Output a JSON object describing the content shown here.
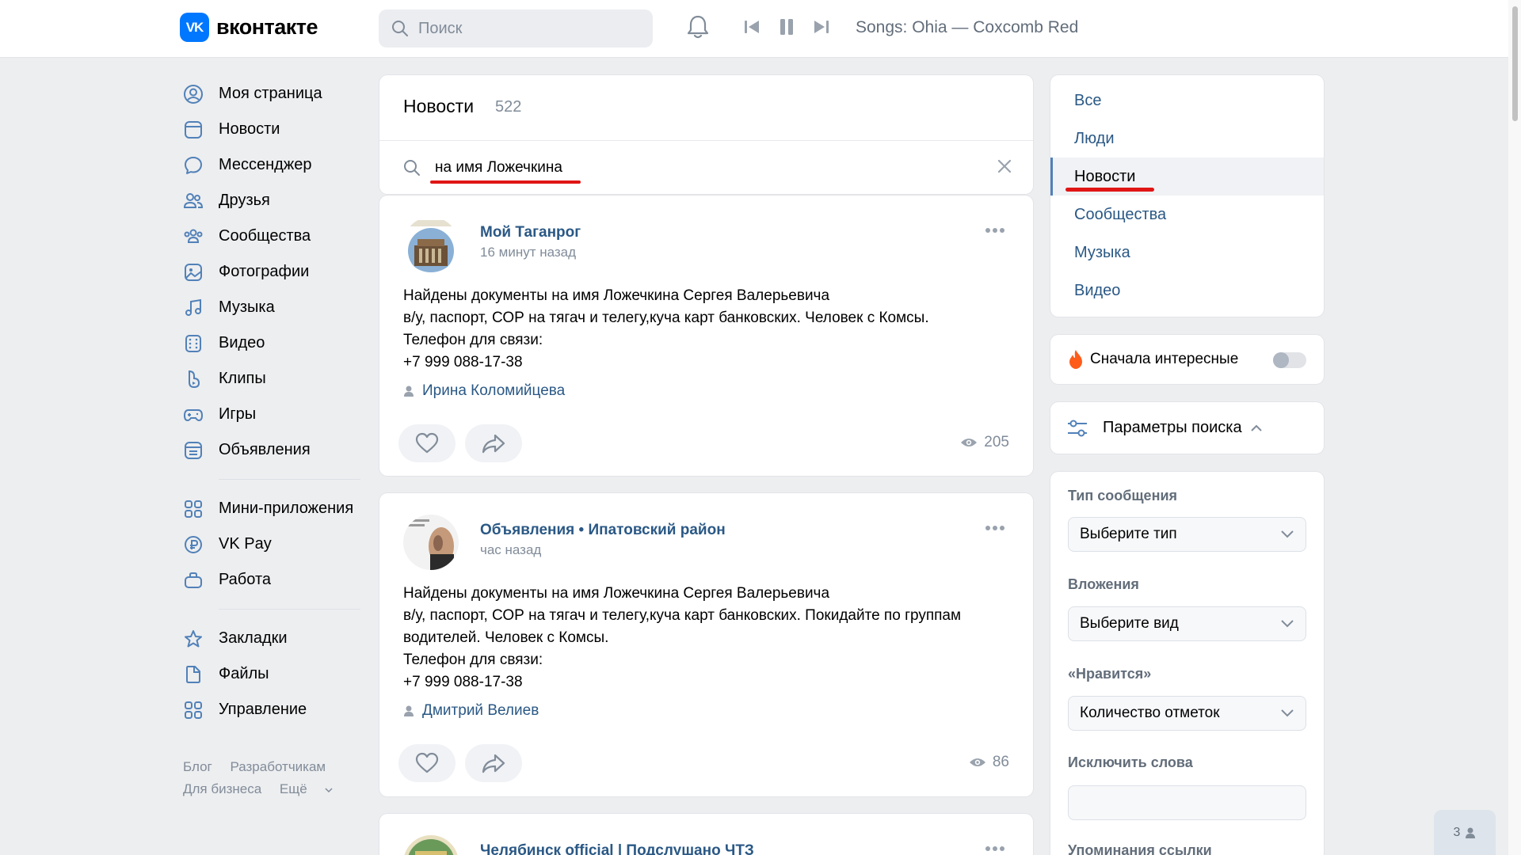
{
  "header": {
    "logo_mark": "VK",
    "logo_text": "вконтакте",
    "search_placeholder": "Поиск",
    "now_playing": "Songs: Ohia — Coxcomb Red"
  },
  "nav": {
    "items": [
      {
        "label": "Моя страница",
        "icon": "user-circle-icon"
      },
      {
        "label": "Новости",
        "icon": "news-icon"
      },
      {
        "label": "Мессенджер",
        "icon": "message-icon"
      },
      {
        "label": "Друзья",
        "icon": "friends-icon"
      },
      {
        "label": "Сообщества",
        "icon": "communities-icon"
      },
      {
        "label": "Фотографии",
        "icon": "photo-icon"
      },
      {
        "label": "Музыка",
        "icon": "music-icon"
      },
      {
        "label": "Видео",
        "icon": "video-icon"
      },
      {
        "label": "Клипы",
        "icon": "clips-icon"
      },
      {
        "label": "Игры",
        "icon": "gamepad-icon"
      },
      {
        "label": "Объявления",
        "icon": "classifieds-icon"
      }
    ],
    "items2": [
      {
        "label": "Мини-приложения",
        "icon": "apps-icon"
      },
      {
        "label": "VK Pay",
        "icon": "vkpay-icon"
      },
      {
        "label": "Работа",
        "icon": "briefcase-icon"
      }
    ],
    "items3": [
      {
        "label": "Закладки",
        "icon": "star-icon"
      },
      {
        "label": "Файлы",
        "icon": "file-icon"
      },
      {
        "label": "Управление",
        "icon": "manage-icon"
      }
    ],
    "footer": {
      "blog": "Блог",
      "developers": "Разработчикам",
      "business": "Для бизнеса",
      "more": "Ещё"
    }
  },
  "main": {
    "title": "Новости",
    "count": "522",
    "search_query": "на имя Ложечкина"
  },
  "posts": [
    {
      "author": "Мой Таганрог",
      "time": "16 минут назад",
      "lines": [
        "Найдены документы на имя Ложечкина Сергея Валерьевича",
        "в/у, паспорт, СОР на тягач и телегу,куча карт банковских. Человек с Комсы.",
        "Телефон для связи:",
        "+7 999 088-17-38"
      ],
      "signer": "Ирина Коломийцева",
      "views": "205"
    },
    {
      "author": "Объявления • Ипатовский район",
      "time": "час назад",
      "lines": [
        "Найдены документы на имя Ложечкина Сергея Валерьевича",
        "в/у, паспорт, СОР на тягач и телегу,куча карт банковских. Покидайте по группам",
        "водителей. Человек с Комсы.",
        "Телефон для связи:",
        "+7 999 088-17-38"
      ],
      "signer": "Дмитрий Велиев",
      "views": "86"
    },
    {
      "author": "Челябинск official | Подслушано ЧТЗ"
    }
  ],
  "filters": {
    "items": [
      "Все",
      "Люди",
      "Новости",
      "Сообщества",
      "Музыка",
      "Видео"
    ],
    "active": "Новости"
  },
  "interesting": {
    "label": "Сначала интересные",
    "enabled": false
  },
  "params": {
    "label": "Параметры поиска"
  },
  "form": {
    "type_label": "Тип сообщения",
    "type_value": "Выберите тип",
    "attach_label": "Вложения",
    "attach_value": "Выберите вид",
    "likes_label": "«Нравится»",
    "likes_value": "Количество отметок",
    "exclude_label": "Исключить слова",
    "exclude_value": "",
    "mentions_label": "Упоминания ссылки"
  },
  "badge": {
    "count": "3"
  },
  "colors": {
    "accent": "#0077ff",
    "link": "#2a5885",
    "annotation": "#e01515",
    "background": "#edeef0"
  }
}
